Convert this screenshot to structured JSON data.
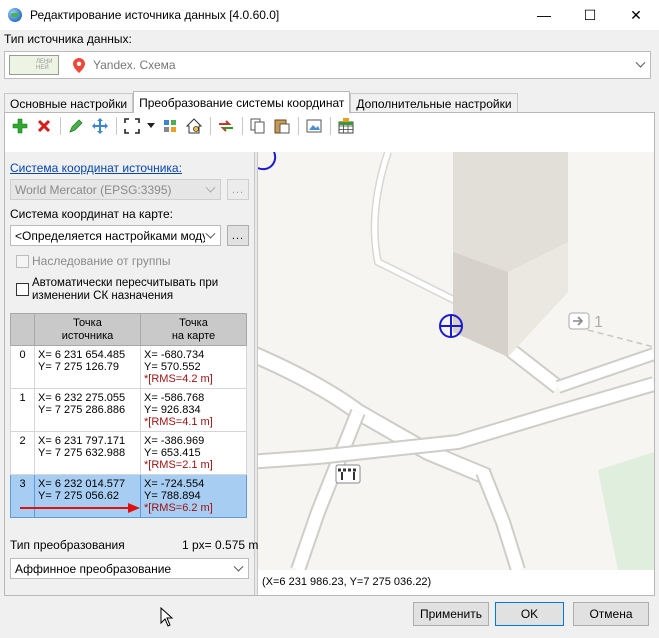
{
  "window": {
    "title": "Редактирование источника данных [4.0.60.0]",
    "minimize": "—",
    "maximize": "☐",
    "close": "✕"
  },
  "source_type": {
    "label": "Тип источника данных:",
    "value": "Yandex. Схема",
    "thumb_text": "ЛЕНИ\nНЕЙ"
  },
  "tabs": [
    {
      "label": "Основные настройки"
    },
    {
      "label": "Преобразование системы координат",
      "active": true
    },
    {
      "label": "Дополнительные настройки"
    }
  ],
  "toolbar": {
    "icons": [
      "add-icon",
      "delete-icon",
      "edit-icon",
      "move-icon",
      "zoom-extent-icon",
      "dropdown-arrow-icon",
      "magnet-icon",
      "home-icon",
      "swap-icon",
      "copy-icon",
      "paste-icon",
      "image-icon",
      "grid-icon"
    ]
  },
  "left": {
    "source_crs_label": "Система координат источника:",
    "source_crs_value": "World Mercator (EPSG:3395)",
    "map_crs_label": "Система координат на карте:",
    "map_crs_value": "<Определяется настройками модуля>",
    "dots": "...",
    "inherit_label": "Наследование от группы",
    "auto_recalc_label_1": "Автоматически пересчитывать при",
    "auto_recalc_label_2": "изменении СК назначения",
    "table": {
      "col_source_1": "Точка",
      "col_source_2": "источника",
      "col_map_1": "Точка",
      "col_map_2": "на карте",
      "rows": [
        {
          "idx": "0",
          "sx": "X= 6 231 654.485",
          "sy": "Y= 7 275 126.79",
          "mx": "X= -680.734",
          "my": "Y= 570.552",
          "rms": "*[RMS=4.2 m]"
        },
        {
          "idx": "1",
          "sx": "X= 6 232 275.055",
          "sy": "Y= 7 275 286.886",
          "mx": "X= -586.768",
          "my": "Y= 926.834",
          "rms": "*[RMS=4.1 m]"
        },
        {
          "idx": "2",
          "sx": "X= 6 231 797.171",
          "sy": "Y= 7 275 632.988",
          "mx": "X= -386.969",
          "my": "Y= 653.415",
          "rms": "*[RMS=2.1 m]"
        },
        {
          "idx": "3",
          "sx": "X= 6 232 014.577",
          "sy": "Y= 7 275 056.62",
          "mx": "X= -724.554",
          "my": "Y= 788.894",
          "rms": "*[RMS=6.2 m]",
          "selected": true
        }
      ]
    },
    "transform_label": "Тип преобразования",
    "scale": "1 px= 0.575 m",
    "transform_value": "Аффинное преобразование"
  },
  "map": {
    "house_number": "1",
    "coord_readout": "(X=6 231 986.23, Y=7 275 036.22)"
  },
  "buttons": {
    "apply": "Применить",
    "ok": "OK",
    "cancel": "Отмена"
  },
  "colors": {
    "accent": "#0078d7",
    "selection": "#a7cdf3",
    "rms": "#9b1010",
    "arrow": "#e01010",
    "marker": "#1a1ad0"
  }
}
